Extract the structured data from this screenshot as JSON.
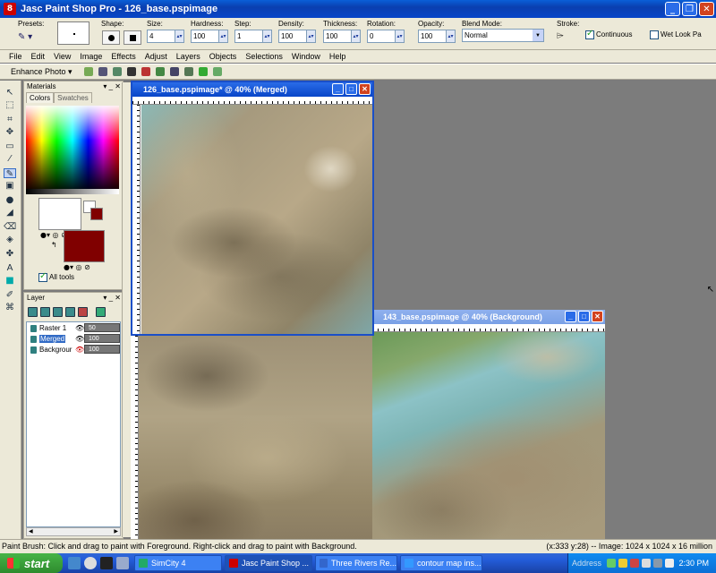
{
  "window": {
    "title": "Jasc Paint Shop Pro - 126_base.pspimage",
    "app_icon_text": "8"
  },
  "tool_options": {
    "presets_label": "Presets:",
    "shape_label": "Shape:",
    "size_label": "Size:",
    "size_value": "4",
    "hardness_label": "Hardness:",
    "hardness_value": "100",
    "step_label": "Step:",
    "step_value": "1",
    "density_label": "Density:",
    "density_value": "100",
    "thickness_label": "Thickness:",
    "thickness_value": "100",
    "rotation_label": "Rotation:",
    "rotation_value": "0",
    "opacity_label": "Opacity:",
    "opacity_value": "100",
    "blend_label": "Blend Mode:",
    "blend_value": "Normal",
    "stroke_label": "Stroke:",
    "continuous_label": "Continuous",
    "continuous_checked": true,
    "wetlook_label": "Wet Look Pa",
    "wetlook_checked": false
  },
  "menu": [
    "File",
    "Edit",
    "View",
    "Image",
    "Effects",
    "Adjust",
    "Layers",
    "Objects",
    "Selections",
    "Window",
    "Help"
  ],
  "toolbar2": {
    "enhance_label": "Enhance Photo ▾"
  },
  "materials": {
    "title": "Materials",
    "tab_colors": "Colors",
    "tab_swatches": "Swatches",
    "all_tools_label": "All tools",
    "all_tools_checked": true,
    "foreground_color": "#ffffff",
    "background_color": "#800000"
  },
  "layers": {
    "title": "Layer",
    "rows": [
      {
        "name": "Raster 1",
        "opacity": "50",
        "selected": false
      },
      {
        "name": "Merged",
        "opacity": "100",
        "selected": true
      },
      {
        "name": "Backgrour",
        "opacity": "100",
        "selected": false
      }
    ]
  },
  "image_windows": [
    {
      "title": "126_base.pspimage* @  40% (Merged)"
    },
    {
      "title": "143_base.pspimage @  40% (Background)"
    }
  ],
  "status": {
    "hint": "Paint Brush: Click and drag to paint with Foreground. Right-click and drag to paint with Background.",
    "info": "(x:333 y:28) -- Image:  1024 x 1024 x 16 million"
  },
  "taskbar": {
    "start_label": "start",
    "tasks": [
      {
        "label": "SimCity 4",
        "active": false,
        "color": "#2a6"
      },
      {
        "label": "Jasc Paint Shop ...",
        "active": true,
        "color": "#c00"
      },
      {
        "label": "Three Rivers Re...",
        "active": false,
        "color": "#36c"
      },
      {
        "label": "contour map ins...",
        "active": false,
        "color": "#39f"
      }
    ],
    "address_label": "Address",
    "clock": "2:30 PM"
  }
}
